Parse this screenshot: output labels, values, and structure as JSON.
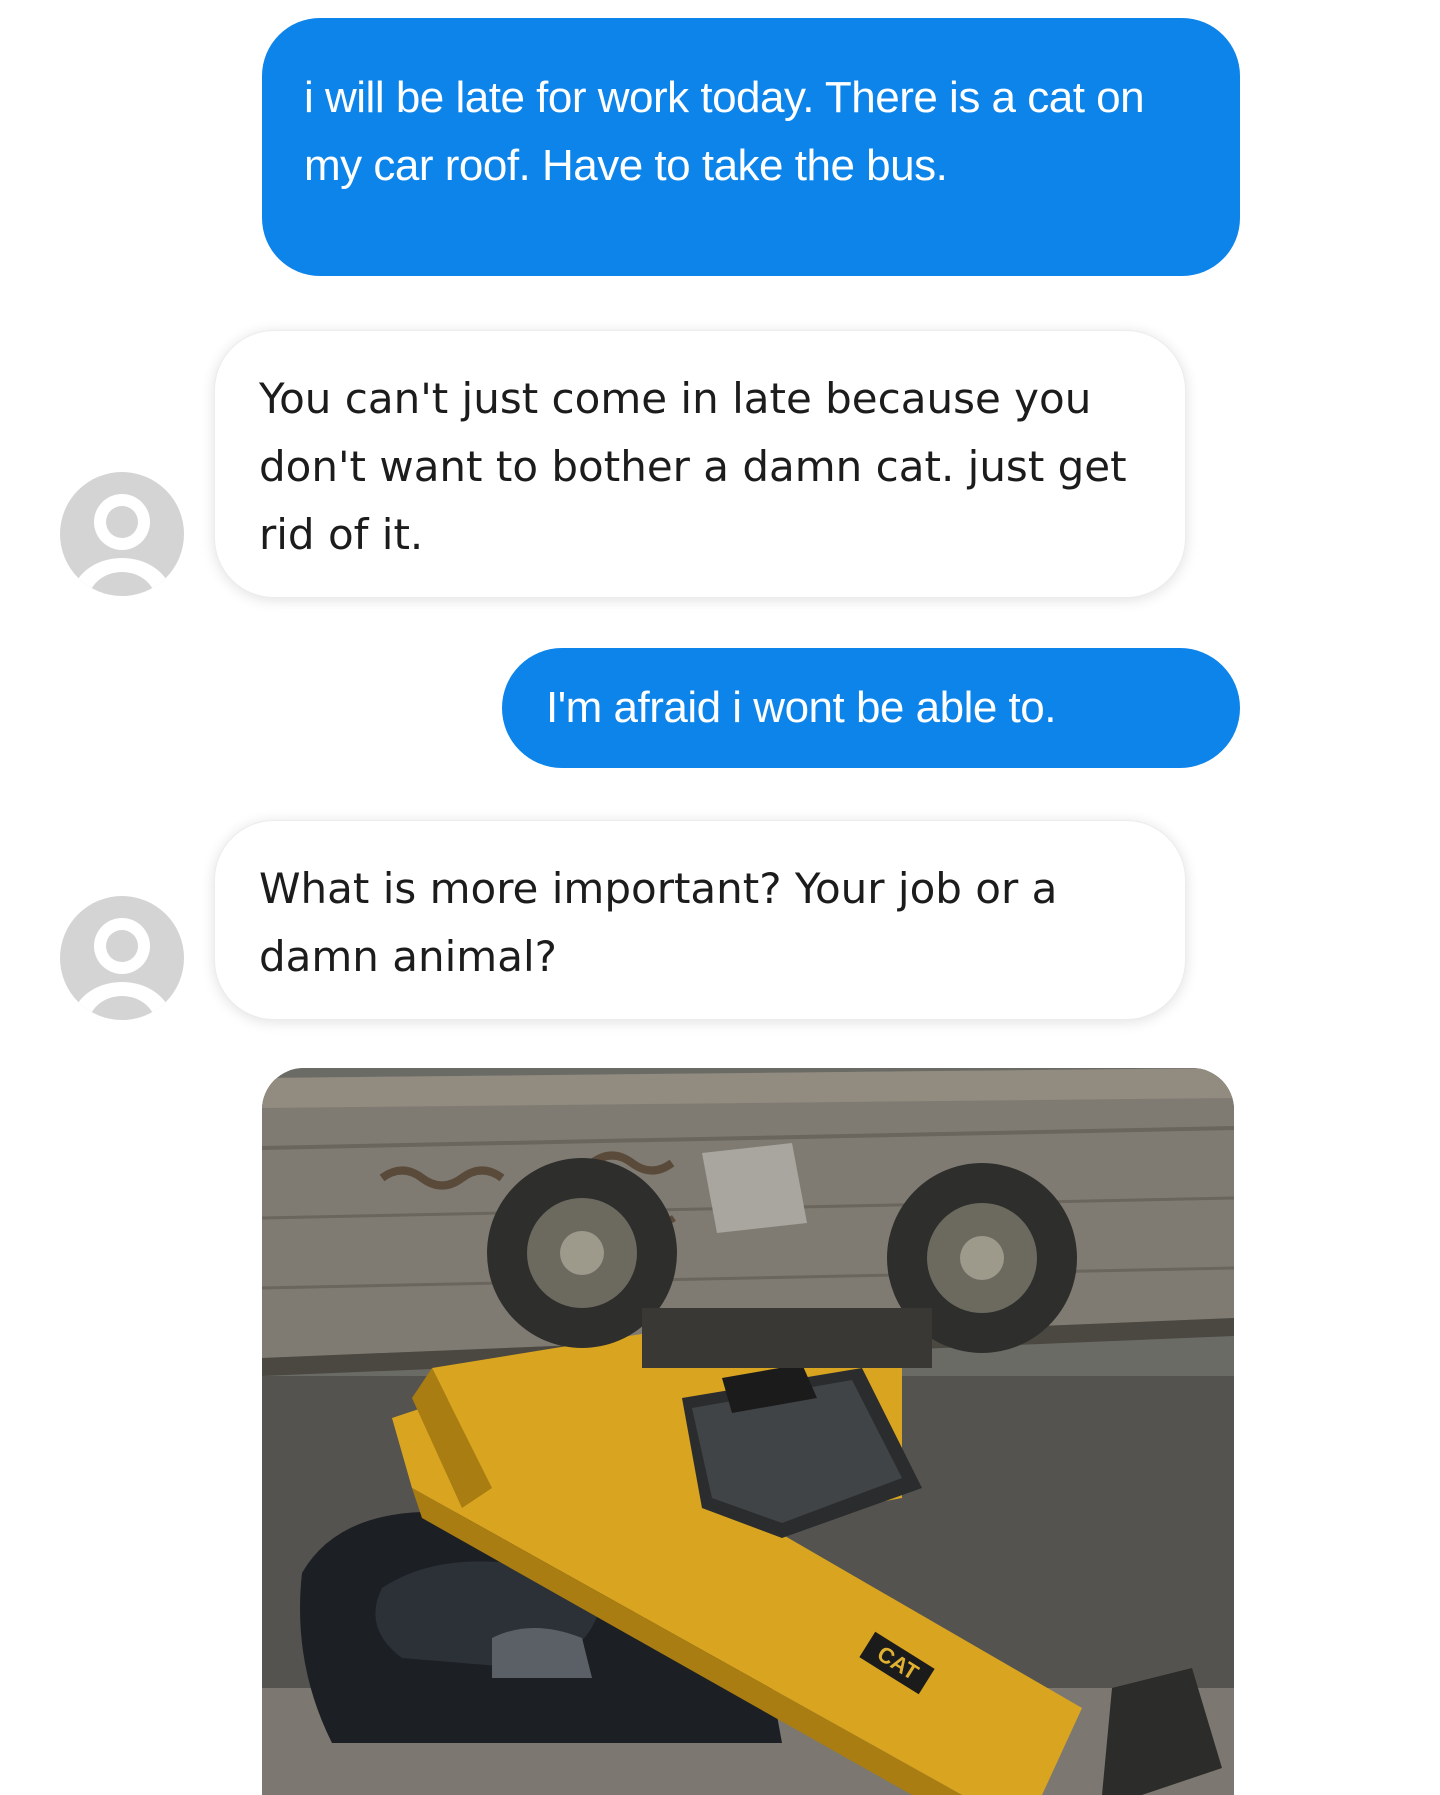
{
  "messages": [
    {
      "sender": "me",
      "text": "i will be late for work today. There is a cat on my car roof. Have to take the bus."
    },
    {
      "sender": "boss",
      "text": "You can't just come in late because you don't want to bother a damn cat. just get rid of it."
    },
    {
      "sender": "me",
      "text": "I'm afraid i wont be able to."
    },
    {
      "sender": "boss",
      "text": "What is more important? Your job or a damn animal?"
    }
  ],
  "photo": {
    "brand_text": "CAT"
  },
  "colors": {
    "sent_bubble": "#0d84ea",
    "received_bubble": "#ffffff",
    "avatar_gray": "#d4d4d4"
  },
  "icons": {
    "avatar": "default-user-avatar-icon"
  }
}
